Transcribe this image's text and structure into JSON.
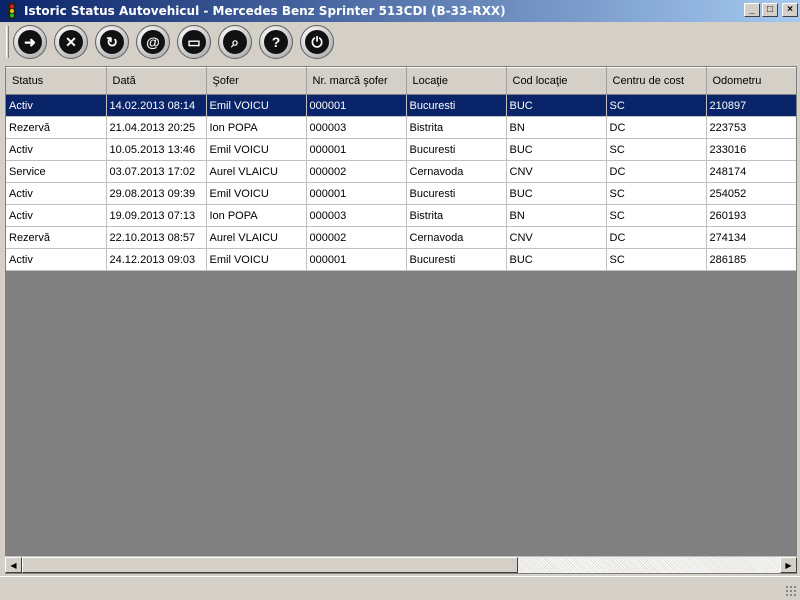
{
  "window": {
    "title": "Istoric Status Autovehicul - Mercedes Benz Sprinter 513CDI (B-33-RXX)",
    "minimize": "_",
    "maximize": "□",
    "close": "×"
  },
  "toolbar": {
    "buttons": [
      {
        "name": "exit",
        "glyph": "➜"
      },
      {
        "name": "delete",
        "glyph": "✕"
      },
      {
        "name": "refresh",
        "glyph": "↻"
      },
      {
        "name": "email",
        "glyph": "@"
      },
      {
        "name": "print",
        "glyph": "▭"
      },
      {
        "name": "search",
        "glyph": "⌕"
      },
      {
        "name": "help",
        "glyph": "?"
      },
      {
        "name": "power",
        "glyph": "⏻"
      }
    ]
  },
  "grid": {
    "columns": [
      "Status",
      "Dată",
      "Şofer",
      "Nr. marcă şofer",
      "Locaţie",
      "Cod locaţie",
      "Centru de cost",
      "Odometru"
    ],
    "rows": [
      [
        "Activ",
        "14.02.2013 08:14",
        "Emil VOICU",
        "000001",
        "Bucuresti",
        "BUC",
        "SC",
        "210897"
      ],
      [
        "Rezervă",
        "21.04.2013 20:25",
        "Ion POPA",
        "000003",
        "Bistrita",
        "BN",
        "DC",
        "223753"
      ],
      [
        "Activ",
        "10.05.2013 13:46",
        "Emil VOICU",
        "000001",
        "Bucuresti",
        "BUC",
        "SC",
        "233016"
      ],
      [
        "Service",
        "03.07.2013 17:02",
        "Aurel VLAICU",
        "000002",
        "Cernavoda",
        "CNV",
        "DC",
        "248174"
      ],
      [
        "Activ",
        "29.08.2013 09:39",
        "Emil VOICU",
        "000001",
        "Bucuresti",
        "BUC",
        "SC",
        "254052"
      ],
      [
        "Activ",
        "19.09.2013 07:13",
        "Ion POPA",
        "000003",
        "Bistrita",
        "BN",
        "SC",
        "260193"
      ],
      [
        "Rezervă",
        "22.10.2013 08:57",
        "Aurel VLAICU",
        "000002",
        "Cernavoda",
        "CNV",
        "DC",
        "274134"
      ],
      [
        "Activ",
        "24.12.2013 09:03",
        "Emil VOICU",
        "000001",
        "Bucuresti",
        "BUC",
        "SC",
        "286185"
      ]
    ],
    "selected_row": 0
  },
  "scrollbar": {
    "left": "◀",
    "right": "▶"
  },
  "colors": {
    "selection": "#0a246a",
    "titlebar": "#0a246a",
    "chrome": "#d4d0c8"
  }
}
